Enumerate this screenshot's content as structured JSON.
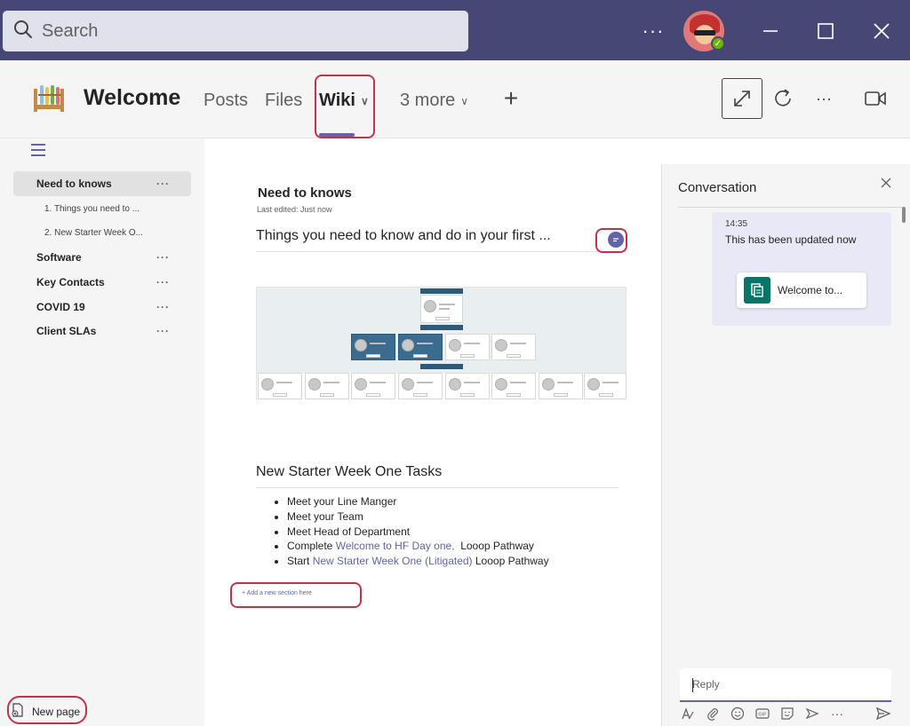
{
  "titlebar": {
    "search_placeholder": "Search",
    "more_label": "···",
    "user_avatar": "user-avatar",
    "presence": "available"
  },
  "header": {
    "app_name": "Welcome",
    "tabs": [
      {
        "label": "Posts"
      },
      {
        "label": "Files"
      },
      {
        "label": "Wiki",
        "active": true
      },
      {
        "label": "3 more"
      }
    ],
    "add_tab": "+",
    "more_label": "···"
  },
  "sidebar": {
    "items": [
      {
        "label": "Need to knows",
        "selected": true,
        "dots": "···"
      },
      {
        "label": "1. Things you need to ..."
      },
      {
        "label": "2. New Starter Week O..."
      },
      {
        "label": "Software",
        "dots": "···"
      },
      {
        "label": "Key Contacts",
        "dots": "···"
      },
      {
        "label": "COVID 19",
        "dots": "···"
      },
      {
        "label": "Client SLAs",
        "dots": "···"
      }
    ],
    "new_page_label": "New page"
  },
  "main": {
    "page_title": "Need to knows",
    "last_edited": "Last edited: Just now",
    "section1_heading": "Things you need to know and do in your first ...",
    "section2_heading": "New Starter Week One Tasks",
    "tasks": [
      {
        "prefix": "Meet your Line Manger",
        "link": "",
        "suffix": ""
      },
      {
        "prefix": "Meet your Team",
        "link": "",
        "suffix": ""
      },
      {
        "prefix": "Meet Head of Department",
        "link": "",
        "suffix": ""
      },
      {
        "prefix": "Complete ",
        "link": "Welcome to HF Day one,",
        "suffix": "  Looop Pathway"
      },
      {
        "prefix": "Start ",
        "link": "New Starter Week One (Litigated)",
        "suffix": " Looop Pathway"
      }
    ],
    "add_section": "+ Add a new section here"
  },
  "conversation": {
    "title": "Conversation",
    "message_time": "14:35",
    "message_text": "This has been updated now",
    "card_label": "Welcome to...",
    "reply_placeholder": "Reply"
  },
  "colors": {
    "titlebar": "#464775",
    "accent": "#6264a7",
    "highlight": "#c4314b",
    "presence": "#6bb700",
    "card_icon": "#077568"
  },
  "icons": [
    "search-icon",
    "more-icon",
    "minimize-icon",
    "maximize-icon",
    "close-icon",
    "wiki-app-icon",
    "chevron-down-icon",
    "add-icon",
    "expand-icon",
    "refresh-icon",
    "video-call-icon",
    "hamburger-icon",
    "new-page-icon",
    "comment-icon",
    "format-icon",
    "attach-icon",
    "emoji-icon",
    "gif-icon",
    "sticker-icon",
    "schedule-icon",
    "send-icon"
  ]
}
